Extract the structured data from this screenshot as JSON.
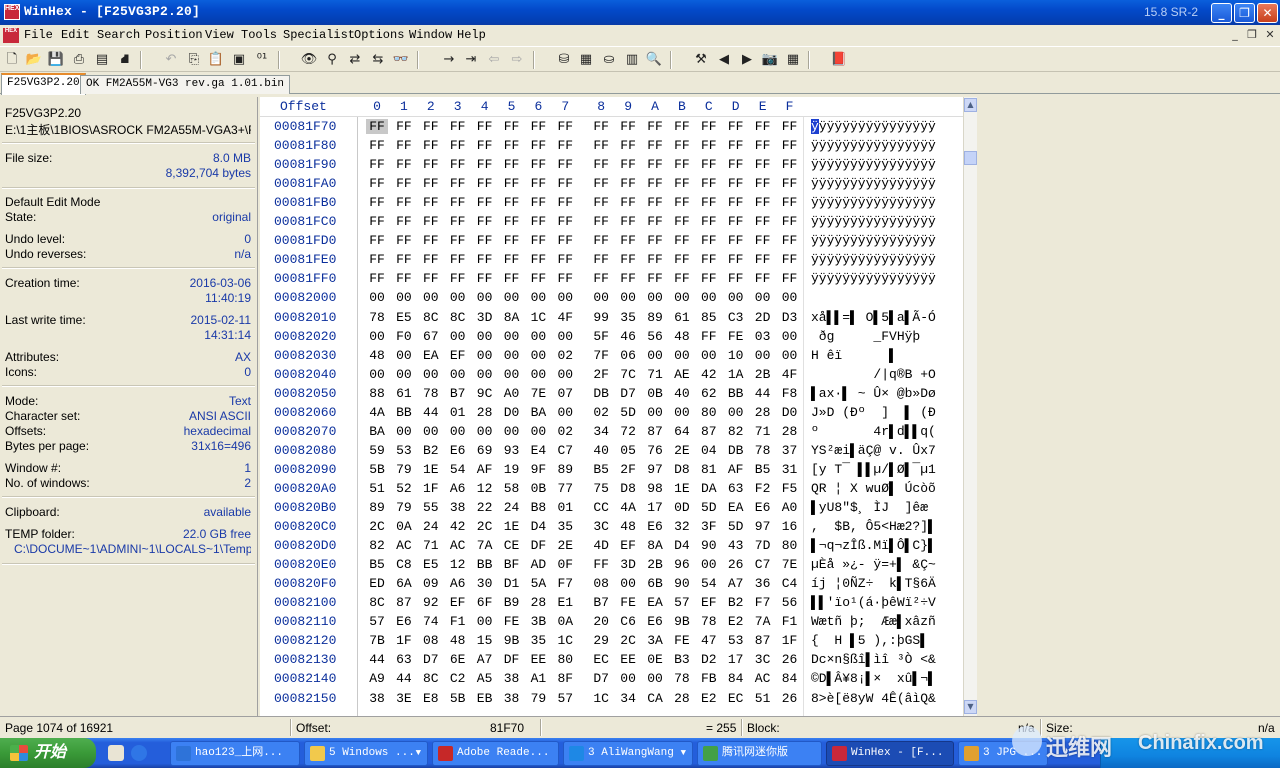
{
  "window": {
    "title": "WinHex - [F25VG3P2.20]",
    "version": "15.8 SR-2",
    "app_icon_text": "HEX"
  },
  "menu": [
    "File",
    "Edit",
    "Search",
    "Position",
    "View",
    "Tools",
    "Specialist",
    "Options",
    "Window",
    "Help"
  ],
  "tabs": [
    {
      "label": "F25VG3P2.20",
      "active": true
    },
    {
      "label": "OK FM2A55M-VG3 rev.ga 1.01.bin",
      "active": false
    }
  ],
  "info": {
    "filename": "F25VG3P2.20",
    "path": "E:\\1主板\\1BIOS\\ASROCK FM2A55M-VGA3+\\F",
    "file_size_label": "File size:",
    "file_size_mb": "8.0 MB",
    "file_size_bytes": "8,392,704 bytes",
    "edit_mode": "Default Edit Mode",
    "state_label": "State:",
    "state": "original",
    "undo_level_label": "Undo level:",
    "undo_level": "0",
    "undo_reverses_label": "Undo reverses:",
    "undo_reverses": "n/a",
    "creation_label": "Creation time:",
    "creation_date": "2016-03-06",
    "creation_time": "11:40:19",
    "lastwrite_label": "Last write time:",
    "lastwrite_date": "2015-02-11",
    "lastwrite_time": "14:31:14",
    "attributes_label": "Attributes:",
    "attributes": "AX",
    "icons_label": "Icons:",
    "icons": "0",
    "mode_label": "Mode:",
    "mode": "Text",
    "charset_label": "Character set:",
    "charset": "ANSI ASCII",
    "offsets_label": "Offsets:",
    "offsets": "hexadecimal",
    "bpp_label": "Bytes per page:",
    "bpp": "31x16=496",
    "window_no_label": "Window #:",
    "window_no": "1",
    "windows_label": "No. of windows:",
    "windows": "2",
    "clipboard_label": "Clipboard:",
    "clipboard": "available",
    "temp_label": "TEMP folder:",
    "temp_free": "22.0 GB free",
    "temp_path": "C:\\DOCUME~1\\ADMINI~1\\LOCALS~1\\Temp"
  },
  "hex": {
    "offset_header": "Offset",
    "columns": [
      "0",
      "1",
      "2",
      "3",
      "4",
      "5",
      "6",
      "7",
      "8",
      "9",
      "A",
      "B",
      "C",
      "D",
      "E",
      "F"
    ],
    "rows": [
      {
        "off": "00081F70",
        "bytes": "FF FF FF FF FF FF FF FF FF FF FF FF FF FF FF FF",
        "text": "ÿÿÿÿÿÿÿÿÿÿÿÿÿÿÿÿ"
      },
      {
        "off": "00081F80",
        "bytes": "FF FF FF FF FF FF FF FF FF FF FF FF FF FF FF FF",
        "text": "ÿÿÿÿÿÿÿÿÿÿÿÿÿÿÿÿ"
      },
      {
        "off": "00081F90",
        "bytes": "FF FF FF FF FF FF FF FF FF FF FF FF FF FF FF FF",
        "text": "ÿÿÿÿÿÿÿÿÿÿÿÿÿÿÿÿ"
      },
      {
        "off": "00081FA0",
        "bytes": "FF FF FF FF FF FF FF FF FF FF FF FF FF FF FF FF",
        "text": "ÿÿÿÿÿÿÿÿÿÿÿÿÿÿÿÿ"
      },
      {
        "off": "00081FB0",
        "bytes": "FF FF FF FF FF FF FF FF FF FF FF FF FF FF FF FF",
        "text": "ÿÿÿÿÿÿÿÿÿÿÿÿÿÿÿÿ"
      },
      {
        "off": "00081FC0",
        "bytes": "FF FF FF FF FF FF FF FF FF FF FF FF FF FF FF FF",
        "text": "ÿÿÿÿÿÿÿÿÿÿÿÿÿÿÿÿ"
      },
      {
        "off": "00081FD0",
        "bytes": "FF FF FF FF FF FF FF FF FF FF FF FF FF FF FF FF",
        "text": "ÿÿÿÿÿÿÿÿÿÿÿÿÿÿÿÿ"
      },
      {
        "off": "00081FE0",
        "bytes": "FF FF FF FF FF FF FF FF FF FF FF FF FF FF FF FF",
        "text": "ÿÿÿÿÿÿÿÿÿÿÿÿÿÿÿÿ"
      },
      {
        "off": "00081FF0",
        "bytes": "FF FF FF FF FF FF FF FF FF FF FF FF FF FF FF FF",
        "text": "ÿÿÿÿÿÿÿÿÿÿÿÿÿÿÿÿ"
      },
      {
        "off": "00082000",
        "bytes": "00 00 00 00 00 00 00 00 00 00 00 00 00 00 00 00",
        "text": ""
      },
      {
        "off": "00082010",
        "bytes": "78 E5 8C 8C 3D 8A 1C 4F 99 35 89 61 85 C3 2D D3",
        "text": "xå▌▌=▌ O▌5▌a▌Ã-Ó"
      },
      {
        "off": "00082020",
        "bytes": "00 F0 67 00 00 00 00 00 5F 46 56 48 FF FE 03 00",
        "text": " ðg     _FVHÿþ  "
      },
      {
        "off": "00082030",
        "bytes": "48 00 EA EF 00 00 00 02 7F 06 00 00 00 10 00 00",
        "text": "H êï      ▌     "
      },
      {
        "off": "00082040",
        "bytes": "00 00 00 00 00 00 00 00 2F 7C 71 AE 42 1A 2B 4F",
        "text": "        /|q®B +O"
      },
      {
        "off": "00082050",
        "bytes": "88 61 78 B7 9C A0 7E 07 DB D7 0B 40 62 BB 44 F8",
        "text": "▌ax·▌ ~ Û× @b»Dø"
      },
      {
        "off": "00082060",
        "bytes": "4A BB 44 01 28 D0 BA 00 02 5D 00 00 80 00 28 D0",
        "text": "J»D (Ðº  ]  ▌ (Ð"
      },
      {
        "off": "00082070",
        "bytes": "BA 00 00 00 00 00 00 02 34 72 87 64 87 82 71 28",
        "text": "º       4r▌d▌▌q("
      },
      {
        "off": "00082080",
        "bytes": "59 53 B2 E6 69 93 E4 C7 40 05 76 2E 04 DB 78 37",
        "text": "YS²æi▌äÇ@ v. Ûx7"
      },
      {
        "off": "00082090",
        "bytes": "5B 79 1E 54 AF 19 9F 89 B5 2F 97 D8 81 AF B5 31",
        "text": "[y T¯ ▌▌µ/▌Ø▌¯µ1"
      },
      {
        "off": "000820A0",
        "bytes": "51 52 1F A6 12 58 0B 77 75 D8 98 1E DA 63 F2 F5",
        "text": "QR ¦ X wuØ▌ Úcòõ"
      },
      {
        "off": "000820B0",
        "bytes": "89 79 55 38 22 24 B8 01 CC 4A 17 0D 5D EA E6 A0",
        "text": "▌yU8\"$¸ ÌJ  ]êæ "
      },
      {
        "off": "000820C0",
        "bytes": "2C 0A 24 42 2C 1E D4 35 3C 48 E6 32 3F 5D 97 16",
        "text": ",  $B, Ô5<Hæ2?]▌ "
      },
      {
        "off": "000820D0",
        "bytes": "82 AC 71 AC 7A CE DF 2E 4D EF 8A D4 90 43 7D 80",
        "text": "▌¬q¬zÎß.Mï▌Ô▌C}▌"
      },
      {
        "off": "000820E0",
        "bytes": "B5 C8 E5 12 BB BF AD 0F FF 3D 2B 96 00 26 C7 7E",
        "text": "µÈå »¿- ÿ=+▌ &Ç~"
      },
      {
        "off": "000820F0",
        "bytes": "ED 6A 09 A6 30 D1 5A F7 08 00 6B 90 54 A7 36 C4",
        "text": "íj ¦0ÑZ÷  k▌T§6Ä"
      },
      {
        "off": "00082100",
        "bytes": "8C 87 92 EF 6F B9 28 E1 B7 FE EA 57 EF B2 F7 56",
        "text": "▌▌'ïo¹(á·þêWï²÷V"
      },
      {
        "off": "00082110",
        "bytes": "57 E6 74 F1 00 FE 3B 0A 20 C6 E6 9B 78 E2 7A F1",
        "text": "Wætñ þ;  Ææ▌xâzñ"
      },
      {
        "off": "00082120",
        "bytes": "7B 1F 08 48 15 9B 35 1C 29 2C 3A FE 47 53 87 1F",
        "text": "{  H ▌5 ),:þGS▌ "
      },
      {
        "off": "00082130",
        "bytes": "44 63 D7 6E A7 DF EE 80 EC EE 0E B3 D2 17 3C 26",
        "text": "Dc×n§ßî▌ìî ³Ò <&"
      },
      {
        "off": "00082140",
        "bytes": "A9 44 8C C2 A5 38 A1 8F D7 00 00 78 FB 84 AC 84",
        "text": "©D▌Â¥8¡▌×  xû▌¬▌"
      },
      {
        "off": "00082150",
        "bytes": "38 3E E8 5B EB 38 79 57 1C 34 CA 28 E2 EC 51 26",
        "text": "8>è[ë8yW 4Ê(âìQ&"
      }
    ]
  },
  "status": {
    "page": "Page 1074 of 16921",
    "offset_label": "Offset:",
    "offset_value": "81F70",
    "value": "= 255",
    "block_label": "Block:",
    "na1": "n/a",
    "size_label": "Size:",
    "na2": "n/a"
  },
  "taskbar": {
    "start_label": "开始",
    "tasks": [
      {
        "label": "hao123_上网...",
        "color": "#2e73d9",
        "dropdown": false,
        "active": false
      },
      {
        "label": "5 Windows ...",
        "color": "#f2c94c",
        "dropdown": true,
        "active": false
      },
      {
        "label": "Adobe Reade...",
        "color": "#c62828",
        "dropdown": false,
        "active": false
      },
      {
        "label": "3 AliWangWang",
        "color": "#1e88e5",
        "dropdown": true,
        "active": false
      },
      {
        "label": "腾讯网迷你版",
        "color": "#43a047",
        "dropdown": false,
        "active": false
      },
      {
        "label": "WinHex - [F...",
        "color": "#c8283a",
        "dropdown": false,
        "active": true
      },
      {
        "label": "3 JPG ...",
        "color": "#e0a030",
        "dropdown": false,
        "active": false
      }
    ],
    "watermark1": "迅维网",
    "watermark2": "Chinafix.com"
  }
}
